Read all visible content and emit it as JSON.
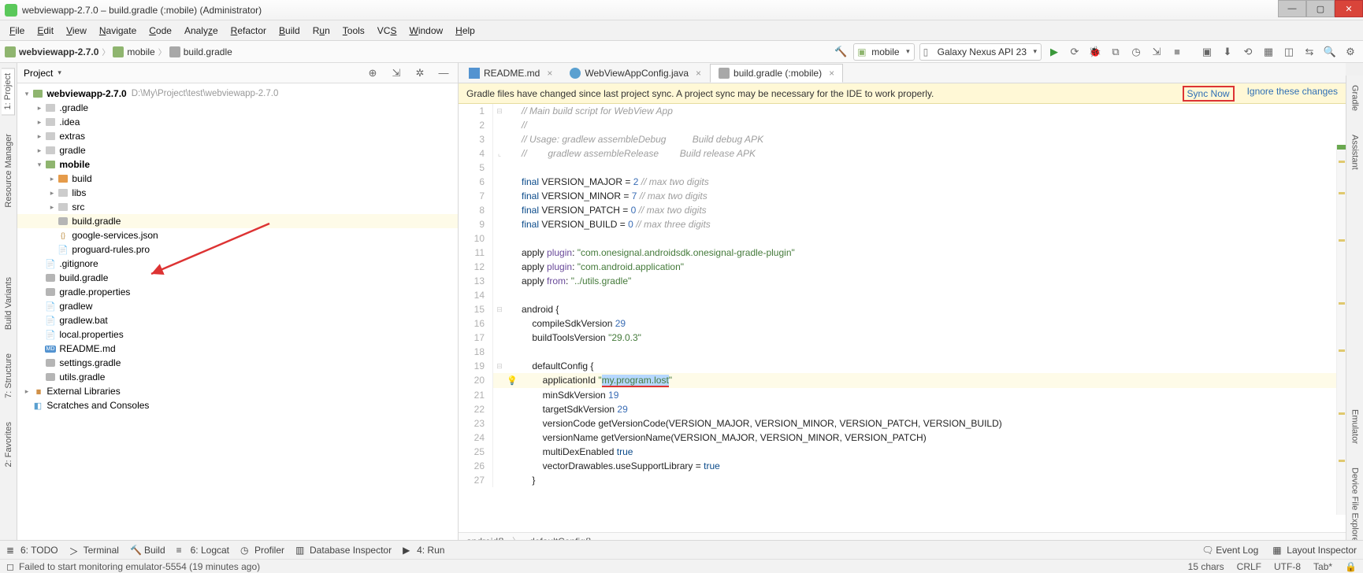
{
  "window": {
    "title": "webviewapp-2.7.0 – build.gradle (:mobile) (Administrator)"
  },
  "menu": {
    "file": "File",
    "edit": "Edit",
    "view": "View",
    "navigate": "Navigate",
    "code": "Code",
    "analyze": "Analyze",
    "refactor": "Refactor",
    "build": "Build",
    "run": "Run",
    "tools": "Tools",
    "vcs": "VCS",
    "window": "Window",
    "help": "Help"
  },
  "crumbs": {
    "p0": "webviewapp-2.7.0",
    "p1": "mobile",
    "p2": "build.gradle"
  },
  "toolbar": {
    "module": "mobile",
    "device": "Galaxy Nexus API 23"
  },
  "leftTabs": {
    "project": "1: Project",
    "resmgr": "Resource Manager",
    "buildvar": "Build Variants",
    "structure": "7: Structure",
    "fav": "2: Favorites"
  },
  "rightTabs": {
    "gradle": "Gradle",
    "assistant": "Assistant",
    "emulator": "Emulator",
    "devexp": "Device File Explorer"
  },
  "project": {
    "header": "Project",
    "root": "webviewapp-2.7.0",
    "rootHint": "D:\\My\\Project\\test\\webviewapp-2.7.0",
    "n_gradle_dir": ".gradle",
    "n_idea": ".idea",
    "n_extras": "extras",
    "n_gradle": "gradle",
    "n_mobile": "mobile",
    "n_build": "build",
    "n_libs": "libs",
    "n_src": "src",
    "n_buildgradle": "build.gradle",
    "n_gservices": "google-services.json",
    "n_proguard": "proguard-rules.pro",
    "n_gitignore": ".gitignore",
    "n_rootbg": "build.gradle",
    "n_gprop": "gradle.properties",
    "n_gradlew": "gradlew",
    "n_gradlewbat": "gradlew.bat",
    "n_localprop": "local.properties",
    "n_readme": "README.md",
    "n_settings": "settings.gradle",
    "n_utils": "utils.gradle",
    "n_extlib": "External Libraries",
    "n_scratch": "Scratches and Consoles"
  },
  "tabs": {
    "t0": "README.md",
    "t1": "WebViewAppConfig.java",
    "t2": "build.gradle (:mobile)"
  },
  "banner": {
    "msg": "Gradle files have changed since last project sync. A project sync may be necessary for the IDE to work properly.",
    "sync": "Sync Now",
    "ignore": "Ignore these changes"
  },
  "code": {
    "l1": "// Main build script for WebView App",
    "l2": "//",
    "l3a": "// Usage: gradlew assembleDebug",
    "l3b": "Build debug APK",
    "l4a": "//        gradlew assembleRelease",
    "l4b": "Build release APK",
    "l6a": "final",
    "l6b": " VERSION_MAJOR = ",
    "l6c": "2",
    "l6d": " // max two digits",
    "l7a": "final",
    "l7b": " VERSION_MINOR = ",
    "l7c": "7",
    "l7d": " // max two digits",
    "l8a": "final",
    "l8b": " VERSION_PATCH = ",
    "l8c": "0",
    "l8d": " // max two digits",
    "l9a": "final",
    "l9b": " VERSION_BUILD = ",
    "l9c": "0",
    "l9d": " // max three digits",
    "l11a": "apply ",
    "l11b": "plugin",
    "l11c": ": ",
    "l11d": "\"com.onesignal.androidsdk.onesignal-gradle-plugin\"",
    "l12a": "apply ",
    "l12b": "plugin",
    "l12c": ": ",
    "l12d": "\"com.android.application\"",
    "l13a": "apply ",
    "l13b": "from",
    "l13c": ": ",
    "l13d": "\"../utils.gradle\"",
    "l15": "android {",
    "l16a": "    compileSdkVersion ",
    "l16b": "29",
    "l17a": "    buildToolsVersion ",
    "l17b": "\"29.0.3\"",
    "l19": "    defaultConfig {",
    "l20a": "        applicationId ",
    "l20q1": "\"",
    "l20b": "my.program.lost",
    "l20q2": "\"",
    "l21a": "        minSdkVersion ",
    "l21b": "19",
    "l22a": "        targetSdkVersion ",
    "l22b": "29",
    "l23": "        versionCode getVersionCode(VERSION_MAJOR, VERSION_MINOR, VERSION_PATCH, VERSION_BUILD)",
    "l24": "        versionName getVersionName(VERSION_MAJOR, VERSION_MINOR, VERSION_PATCH)",
    "l25a": "        multiDexEnabled ",
    "l25b": "true",
    "l26a": "        vectorDrawables.useSupportLibrary = ",
    "l26b": "true",
    "l27": "    }"
  },
  "edCrumb": {
    "c0": "android{}",
    "c1": "defaultConfig{}"
  },
  "bottom": {
    "todo": "6: TODO",
    "terminal": "Terminal",
    "build": "Build",
    "logcat": "6: Logcat",
    "profiler": "Profiler",
    "dbins": "Database Inspector",
    "run": "4: Run",
    "eventlog": "Event Log",
    "layoutinsp": "Layout Inspector"
  },
  "status": {
    "msg": "Failed to start monitoring emulator-5554 (19 minutes ago)",
    "chars": "15 chars",
    "crlf": "CRLF",
    "enc": "UTF-8",
    "indent": "Tab*"
  }
}
